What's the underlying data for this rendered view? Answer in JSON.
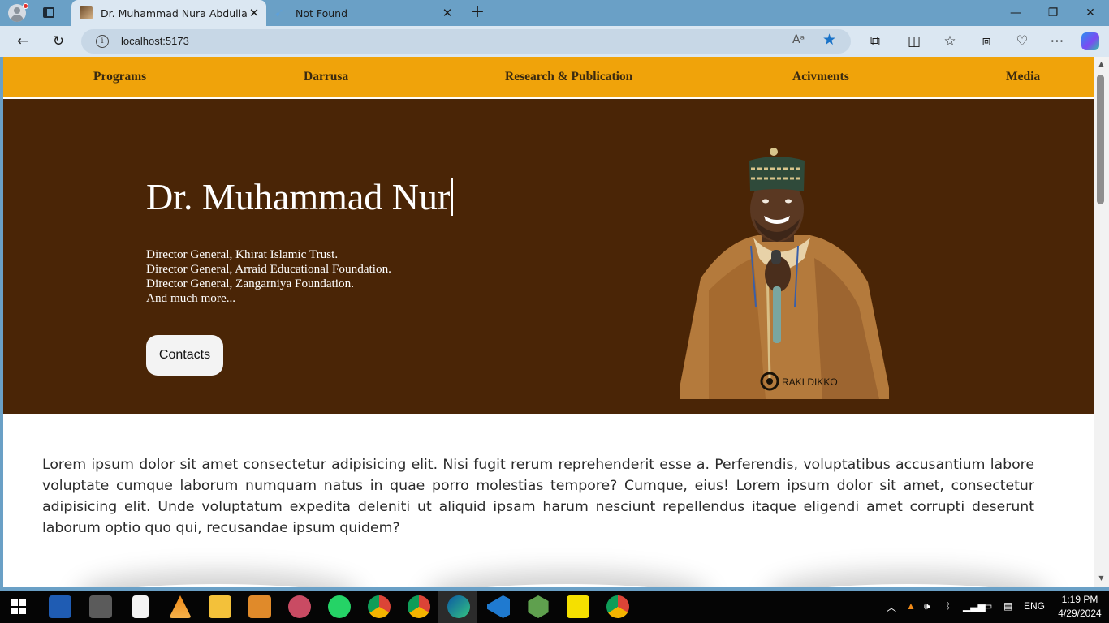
{
  "browser": {
    "tabs": [
      {
        "title": "Dr. Muhammad Nura Abdullahi",
        "active": true
      },
      {
        "title": "Not Found",
        "active": false
      }
    ],
    "url": "localhost:5173",
    "read_aloud_label": "Aᵃ",
    "window_controls": [
      "minimize-icon",
      "restore-icon",
      "close-icon"
    ]
  },
  "nav": {
    "items": [
      {
        "label": "Programs"
      },
      {
        "label": "Darrusa"
      },
      {
        "label": "Research & Publication"
      },
      {
        "label": "Acivments"
      },
      {
        "label": "Media"
      }
    ]
  },
  "hero": {
    "name": "Dr. Muhammad Nur",
    "roles": [
      "Director General, Khirat Islamic Trust.",
      "Director General, Arraid Educational Foundation.",
      "Director General, Zangarniya Foundation.",
      "And much more..."
    ],
    "contacts_label": "Contacts",
    "photo_watermark": "RAKI DIKKO"
  },
  "intro": {
    "text": "Lorem ipsum dolor sit amet consectetur adipisicing elit. Nisi fugit rerum reprehenderit esse a. Perferendis, voluptatibus accusantium labore voluptate cumque laborum numquam natus in quae porro molestias tempore? Cumque, eius! Lorem ipsum dolor sit amet, consectetur adipisicing elit. Unde voluptatum expedita deleniti ut aliquid ipsam harum nesciunt repellendus itaque eligendi amet corrupti deserunt laborum optio quo qui, recusandae ipsum quidem?"
  },
  "taskbar": {
    "apps": [
      "word-icon",
      "calculator-icon",
      "notepad-icon",
      "vlc-icon",
      "file-explorer-icon",
      "media-player-icon",
      "snipping-tool-icon",
      "whatsapp-icon",
      "chrome-icon",
      "chrome-icon",
      "edge-icon",
      "vscode-icon",
      "nodejs-icon",
      "digi-icon",
      "chrome-profile-icon"
    ],
    "language": "ENG",
    "time": "1:19 PM",
    "date": "4/29/2024"
  },
  "colors": {
    "nav_bg": "#f0a30a",
    "hero_bg": "#4a2506",
    "browser_frame": "#6aa0c6",
    "accent_star": "#1a73c8"
  }
}
